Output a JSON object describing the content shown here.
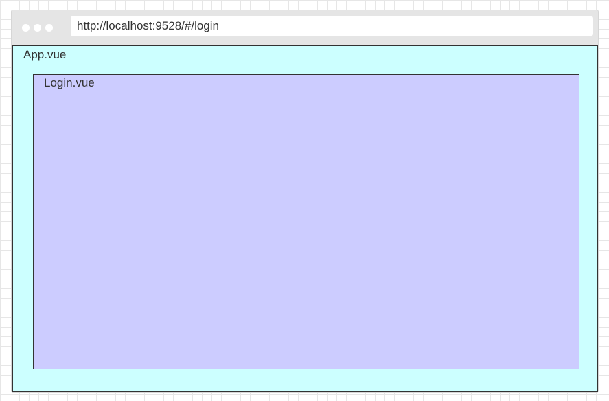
{
  "browser": {
    "url": "http://localhost:9528/#/login",
    "dots_color": "#ffffff"
  },
  "app_component": {
    "label": "App.vue",
    "fill": "#ccffff"
  },
  "login_component": {
    "label": "Login.vue",
    "fill": "#ccccff"
  }
}
